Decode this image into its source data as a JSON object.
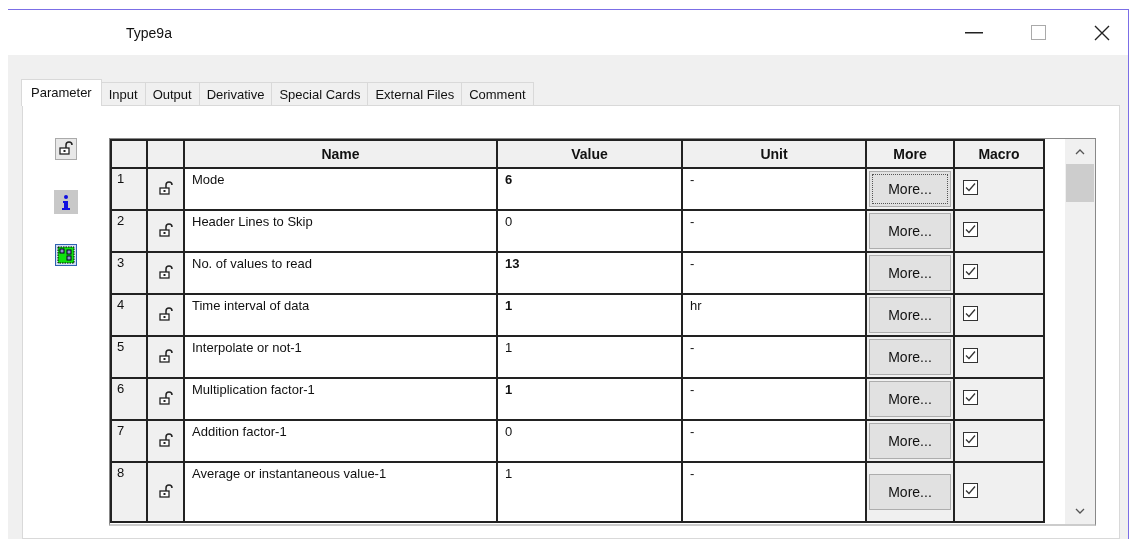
{
  "window": {
    "title": "Type9a"
  },
  "tabs": [
    {
      "label": "Parameter",
      "selected": true
    },
    {
      "label": "Input",
      "selected": false
    },
    {
      "label": "Output",
      "selected": false
    },
    {
      "label": "Derivative",
      "selected": false
    },
    {
      "label": "Special Cards",
      "selected": false
    },
    {
      "label": "External Files",
      "selected": false
    },
    {
      "label": "Comment",
      "selected": false
    }
  ],
  "table": {
    "columns": [
      "Name",
      "Value",
      "Unit",
      "More",
      "Macro"
    ],
    "rows": [
      {
        "number": "1",
        "name": "Mode",
        "value": "6",
        "value_bold": true,
        "unit": "-",
        "more": "More...",
        "focused": true,
        "macro": true
      },
      {
        "number": "2",
        "name": "Header Lines to Skip",
        "value": "0",
        "value_bold": false,
        "unit": "-",
        "more": "More...",
        "focused": false,
        "macro": true
      },
      {
        "number": "3",
        "name": "No. of values to read",
        "value": "13",
        "value_bold": true,
        "unit": "-",
        "more": "More...",
        "focused": false,
        "macro": true
      },
      {
        "number": "4",
        "name": "Time interval of data",
        "value": "1",
        "value_bold": true,
        "unit": "hr",
        "more": "More...",
        "focused": false,
        "macro": true
      },
      {
        "number": "5",
        "name": "Interpolate or not-1",
        "value": "1",
        "value_bold": false,
        "unit": "-",
        "more": "More...",
        "focused": false,
        "macro": true
      },
      {
        "number": "6",
        "name": "Multiplication factor-1",
        "value": "1",
        "value_bold": true,
        "unit": "-",
        "more": "More...",
        "focused": false,
        "macro": true
      },
      {
        "number": "7",
        "name": "Addition factor-1",
        "value": "0",
        "value_bold": false,
        "unit": "-",
        "more": "More...",
        "focused": false,
        "macro": true
      },
      {
        "number": "8",
        "name": "Average or instantaneous value-1",
        "value": "1",
        "value_bold": false,
        "unit": "-",
        "more": "More...",
        "focused": false,
        "macro": true
      }
    ]
  }
}
